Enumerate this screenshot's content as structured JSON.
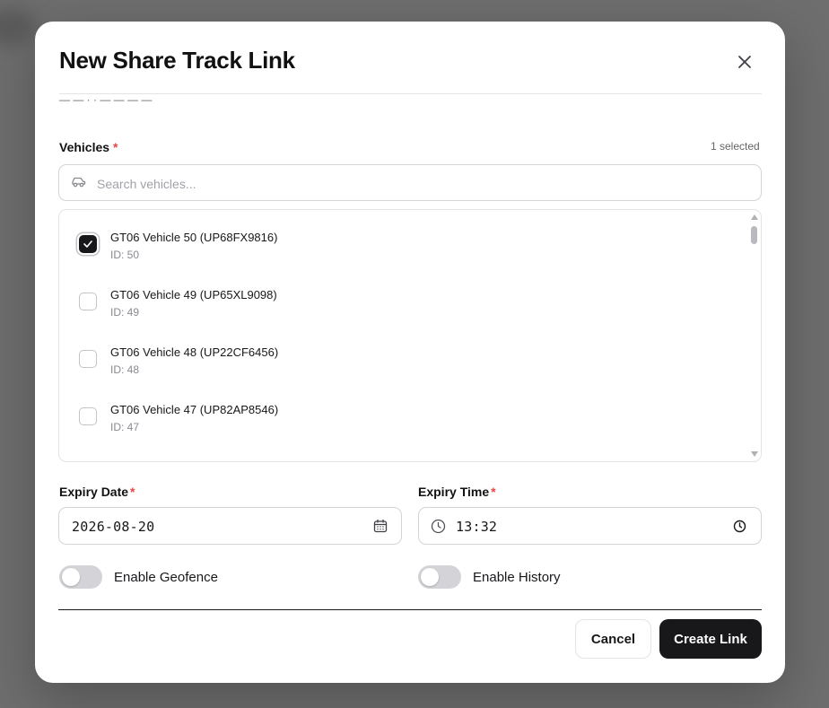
{
  "modal": {
    "title": "New Share Track Link",
    "clipped_text": "— — ·  ·  — — — —"
  },
  "vehicles": {
    "label": "Vehicles",
    "required_mark": "*",
    "selected_count": "1 selected",
    "search": {
      "placeholder": "Search vehicles...",
      "value": ""
    },
    "items": [
      {
        "name": "GT06 Vehicle 50 (UP68FX9816)",
        "id": "ID: 50",
        "checked": true
      },
      {
        "name": "GT06 Vehicle 49 (UP65XL9098)",
        "id": "ID: 49",
        "checked": false
      },
      {
        "name": "GT06 Vehicle 48 (UP22CF6456)",
        "id": "ID: 48",
        "checked": false
      },
      {
        "name": "GT06 Vehicle 47 (UP82AP8546)",
        "id": "ID: 47",
        "checked": false
      }
    ]
  },
  "expiry": {
    "date_label": "Expiry Date",
    "date_value": "2026-08-20",
    "time_label": "Expiry Time",
    "time_value": "13:32",
    "required_mark": "*"
  },
  "toggles": {
    "geofence_label": "Enable Geofence",
    "geofence_on": false,
    "history_label": "Enable History",
    "history_on": false
  },
  "footer": {
    "cancel_label": "Cancel",
    "create_label": "Create Link"
  },
  "icons": {
    "close": "close-icon",
    "search": "car-icon",
    "calendar": "calendar-icon",
    "clock": "clock-icon",
    "check": "check-icon"
  },
  "colors": {
    "accent": "#18181b",
    "required": "#ef4444",
    "backdrop": "#6e6e6e"
  }
}
